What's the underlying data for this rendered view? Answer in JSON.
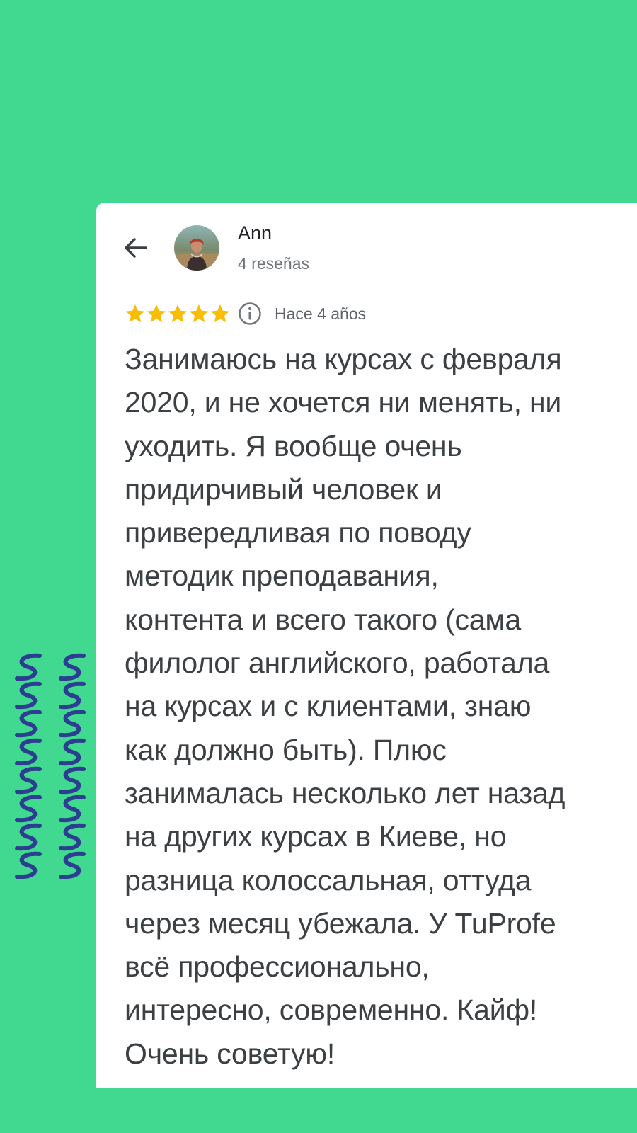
{
  "colors": {
    "background": "#41d98f",
    "card": "#ffffff",
    "star": "#fbbc04",
    "wave": "#2c3e8f"
  },
  "header": {
    "back_icon": "arrow-left-icon",
    "avatar_icon": "user-avatar",
    "name": "Ann",
    "reviews_count": "4 reseñas"
  },
  "rating": {
    "stars": 5,
    "max_stars": 5,
    "info_icon": "info-icon",
    "time_ago": "Hace 4 años"
  },
  "review": {
    "lines": [
      "Занимаюсь на курсах с февраля",
      "2020, и не хочется ни менять, ни",
      "уходить. Я вообще очень",
      "придирчивый человек и",
      "привередливая по поводу",
      "методик преподавания,",
      "контента и всего такого (сама",
      "филолог английского, работала",
      "на курсах и с клиентами, знаю",
      "как должно быть). Плюс",
      "занималась несколько лет назад",
      "на других курсах в Киеве, но",
      "разница колоссальная, оттуда",
      "через месяц убежала. У TuProfe",
      "всё профессионально,",
      "интересно, современно. Кайф!",
      "Очень советую!"
    ]
  }
}
